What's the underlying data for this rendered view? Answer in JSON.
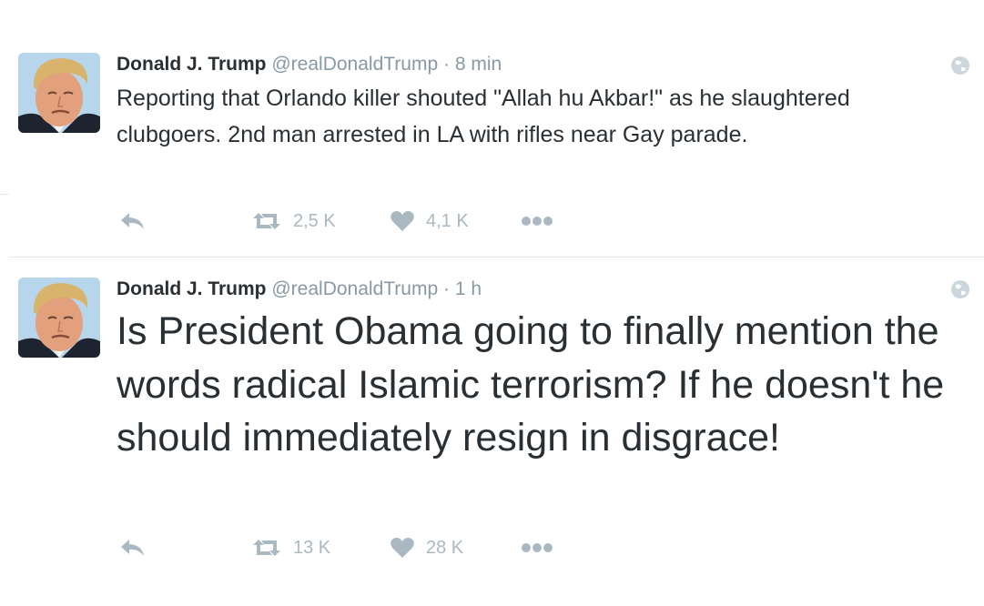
{
  "tweets": [
    {
      "fullname": "Donald J. Trump",
      "username": "@realDonaldTrump",
      "separator": "·",
      "time": "8 min",
      "text": "Reporting that Orlando killer shouted \"Allah hu Akbar!\" as he slaughtered clubgoers. 2nd man arrested in LA with rifles near Gay parade.",
      "retweets": "2,5 K",
      "likes": "4,1 K"
    },
    {
      "fullname": "Donald J. Trump",
      "username": "@realDonaldTrump",
      "separator": "·",
      "time": "1 h",
      "text": "Is President Obama going to finally mention the words radical Islamic terrorism? If he doesn't he should immediately resign in disgrace!",
      "retweets": "13 K",
      "likes": "28 K"
    }
  ],
  "icons": {
    "globe": "globe-icon",
    "reply": "reply-icon",
    "retweet": "retweet-icon",
    "like": "heart-icon",
    "more": "more-icon"
  },
  "colors": {
    "text": "#292f33",
    "secondary": "#8899a6",
    "action": "#aab8c2",
    "divider": "#e1e8ed",
    "avatar_bg": "#b7d6ec"
  }
}
